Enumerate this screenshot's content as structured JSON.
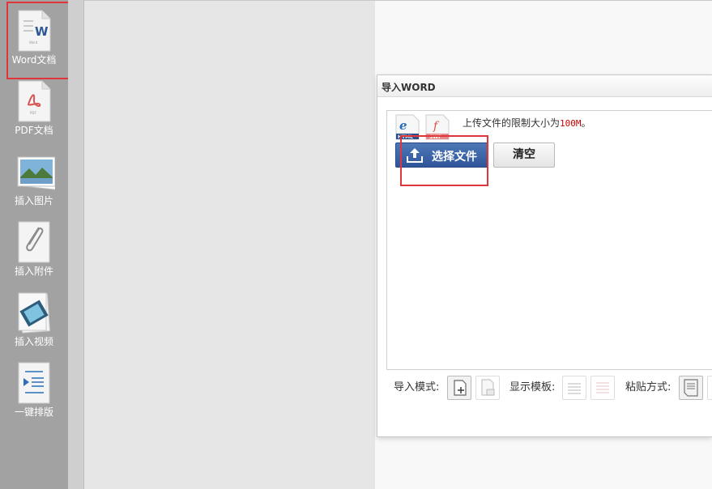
{
  "sidebar": {
    "items": [
      {
        "label": "Word文档"
      },
      {
        "label": "PDF文档"
      },
      {
        "label": "插入图片"
      },
      {
        "label": "插入附件"
      },
      {
        "label": "插入视频"
      },
      {
        "label": "一键排版"
      }
    ]
  },
  "dialog": {
    "title": "导入WORD",
    "limit_prefix": "上传文件的限制大小为",
    "limit_value": "100M",
    "limit_suffix": "。",
    "file_types": [
      "HTML",
      "SWF"
    ],
    "choose_button": "选择文件",
    "clear_button": "清空",
    "options": {
      "import_mode_label": "导入模式:",
      "display_template_label": "显示模板:",
      "paste_mode_label": "粘贴方式:"
    }
  },
  "colors": {
    "highlight": "#e0353a",
    "primary_button": "#3a64a8",
    "limit_value": "#cc0000"
  }
}
